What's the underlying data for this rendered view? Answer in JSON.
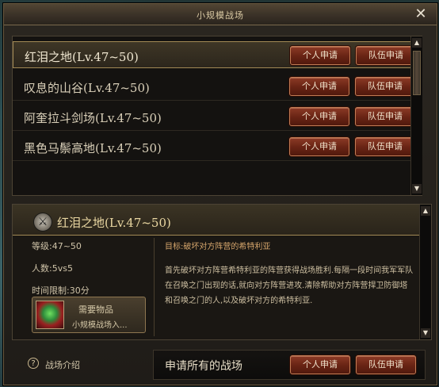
{
  "window": {
    "title": "小规模战场"
  },
  "battlefields": [
    {
      "label": "红泪之地(Lv.47~50)",
      "selected": true
    },
    {
      "label": "叹息的山谷(Lv.47~50)",
      "selected": false
    },
    {
      "label": "阿奎拉斗剑场(Lv.47~50)",
      "selected": false
    },
    {
      "label": "黑色马鬃高地(Lv.47~50)",
      "selected": false
    }
  ],
  "buttons": {
    "personal": "个人申请",
    "team": "队伍申请"
  },
  "detail": {
    "title": "红泪之地(Lv.47~50)",
    "level": "等级:47~50",
    "players": "人数:5vs5",
    "time_limit": "时间限制:30分",
    "reward_title": "需要物品",
    "reward_name": "小规模战场入...",
    "objective": "目标:破坏对方阵营的希特利亚",
    "description": "首先破坏对方阵营希特利亚的阵营获得战场胜利.每隔一段时间我军军队在召唤之门出现的话,就向对方阵营进攻.清除帮助对方阵营捍卫防御塔和召唤之门的人,以及破坏对方的希特利亚."
  },
  "footer": {
    "help_label": "战场介绍",
    "apply_all_label": "申请所有的战场"
  },
  "colors": {
    "button_red": "#6a2515",
    "gold_text": "#ead7a2",
    "objective_text": "#d6a66c"
  },
  "icons": [
    "close-icon",
    "crossed-swords-icon",
    "help-icon",
    "reward-item-icon"
  ]
}
